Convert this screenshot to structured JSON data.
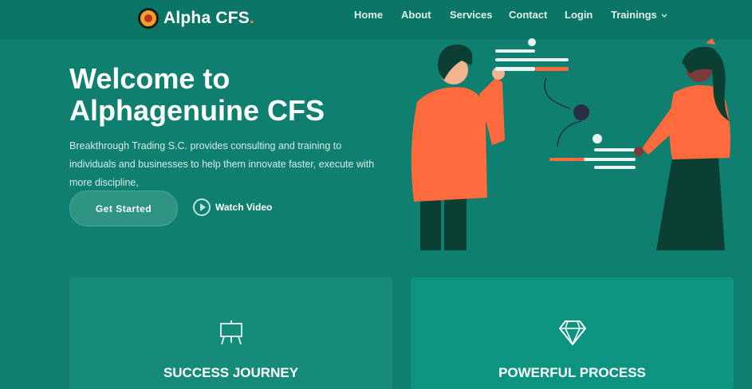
{
  "brand": {
    "name": "Alpha CFS",
    "dot": "."
  },
  "nav": {
    "items": [
      "Home",
      "About",
      "Services",
      "Contact",
      "Login",
      "Trainings"
    ]
  },
  "hero": {
    "title_line1": "Welcome to",
    "title_line2": "Alphagenuine CFS",
    "description": "Breakthrough Trading S.C. provides consulting and training to individuals and businesses to help them innovate faster, execute with more discipline,",
    "cta_primary": "Get Started",
    "cta_secondary": "Watch Video"
  },
  "cards": [
    {
      "title": "SUCCESS JOURNEY",
      "icon": "presentation-board-icon"
    },
    {
      "title": "POWERFUL PROCESS",
      "icon": "diamond-icon"
    }
  ],
  "colors": {
    "background": "#0f8070",
    "header": "#0c7666",
    "accent": "#ff6a3d"
  }
}
